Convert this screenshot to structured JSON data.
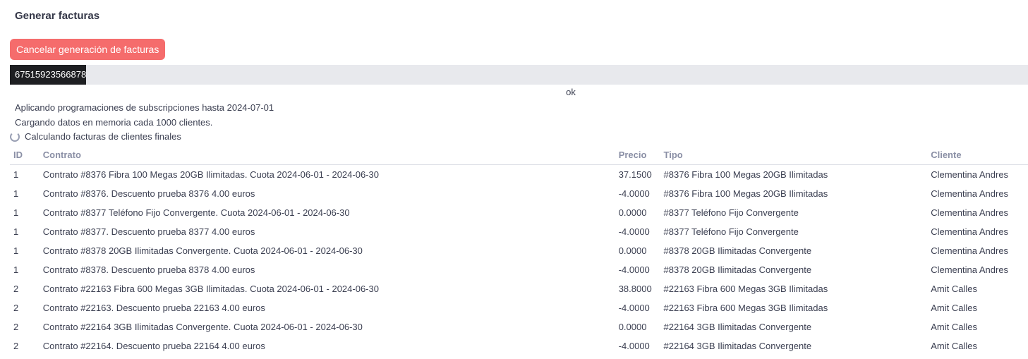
{
  "page": {
    "title": "Generar facturas"
  },
  "actions": {
    "cancel_label": "Cancelar generación de facturas",
    "cancel_color": "#f56c6c"
  },
  "progress": {
    "value": "67515923566878",
    "fraction": 0.075,
    "status": "ok",
    "fill_color": "#1e1f22",
    "track_color": "#e8e9ed"
  },
  "log": {
    "line1": "Aplicando programaciones de subscripciones hasta 2024-07-01",
    "line2": "Cargando datos en memoria cada 1000 clientes.",
    "line3": "Calculando facturas de clientes finales",
    "spinner_icon": "loading-spinner-icon"
  },
  "table": {
    "headers": {
      "id": "ID",
      "contrato": "Contrato",
      "precio": "Precio",
      "tipo": "Tipo",
      "cliente": "Cliente"
    },
    "rows": [
      {
        "id": "1",
        "contrato": "Contrato #8376 Fibra 100 Megas 20GB Ilimitadas. Cuota 2024-06-01 - 2024-06-30",
        "precio": "37.1500",
        "tipo": "#8376 Fibra 100 Megas 20GB Ilimitadas",
        "cliente": "Clementina Andres"
      },
      {
        "id": "1",
        "contrato": "Contrato #8376. Descuento prueba 8376 4.00 euros",
        "precio": "-4.0000",
        "tipo": "#8376 Fibra 100 Megas 20GB Ilimitadas",
        "cliente": "Clementina Andres"
      },
      {
        "id": "1",
        "contrato": "Contrato #8377 Teléfono Fijo Convergente. Cuota 2024-06-01 - 2024-06-30",
        "precio": "0.0000",
        "tipo": "#8377 Teléfono Fijo Convergente",
        "cliente": "Clementina Andres"
      },
      {
        "id": "1",
        "contrato": "Contrato #8377. Descuento prueba 8377 4.00 euros",
        "precio": "-4.0000",
        "tipo": "#8377 Teléfono Fijo Convergente",
        "cliente": "Clementina Andres"
      },
      {
        "id": "1",
        "contrato": "Contrato #8378 20GB Ilimitadas Convergente. Cuota 2024-06-01 - 2024-06-30",
        "precio": "0.0000",
        "tipo": "#8378 20GB Ilimitadas Convergente",
        "cliente": "Clementina Andres"
      },
      {
        "id": "1",
        "contrato": "Contrato #8378. Descuento prueba 8378 4.00 euros",
        "precio": "-4.0000",
        "tipo": "#8378 20GB Ilimitadas Convergente",
        "cliente": "Clementina Andres"
      },
      {
        "id": "2",
        "contrato": "Contrato #22163 Fibra 600 Megas 3GB Ilimitadas. Cuota 2024-06-01 - 2024-06-30",
        "precio": "38.8000",
        "tipo": "#22163 Fibra 600 Megas 3GB Ilimitadas",
        "cliente": "Amit Calles"
      },
      {
        "id": "2",
        "contrato": "Contrato #22163. Descuento prueba 22163 4.00 euros",
        "precio": "-4.0000",
        "tipo": "#22163 Fibra 600 Megas 3GB Ilimitadas",
        "cliente": "Amit Calles"
      },
      {
        "id": "2",
        "contrato": "Contrato #22164 3GB Ilimitadas Convergente. Cuota 2024-06-01 - 2024-06-30",
        "precio": "0.0000",
        "tipo": "#22164 3GB Ilimitadas Convergente",
        "cliente": "Amit Calles"
      },
      {
        "id": "2",
        "contrato": "Contrato #22164. Descuento prueba 22164 4.00 euros",
        "precio": "-4.0000",
        "tipo": "#22164 3GB Ilimitadas Convergente",
        "cliente": "Amit Calles"
      }
    ]
  }
}
